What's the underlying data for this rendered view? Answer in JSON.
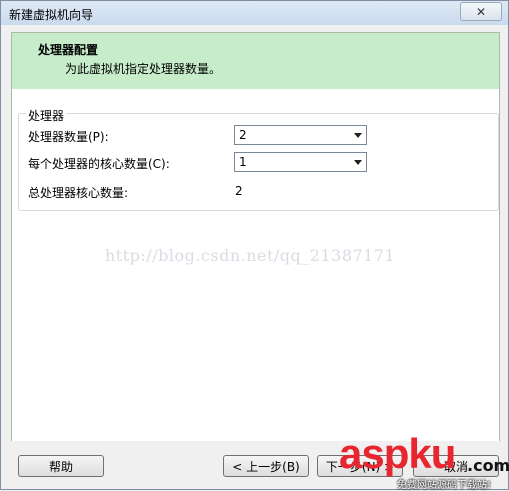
{
  "window": {
    "title": "新建虚拟机向导",
    "close_label": "✕"
  },
  "header": {
    "title": "处理器配置",
    "subtitle": "为此虚拟机指定处理器数量。"
  },
  "processor_group": {
    "title": "处理器",
    "count_label": "处理器数量(P):",
    "count_value": "2",
    "cores_label": "每个处理器的核心数量(C):",
    "cores_value": "1",
    "total_label": "总处理器核心数量:",
    "total_value": "2"
  },
  "watermark_text": "http://blog.csdn.net/qq_21387171",
  "footer": {
    "help_label": "帮助",
    "back_label": "< 上一步(B)",
    "next_label": "下一步(N) >",
    "cancel_label": "取消"
  },
  "logo": {
    "main": "aspku",
    "com": ".com",
    "sub": "免费网站源码下载站!"
  }
}
